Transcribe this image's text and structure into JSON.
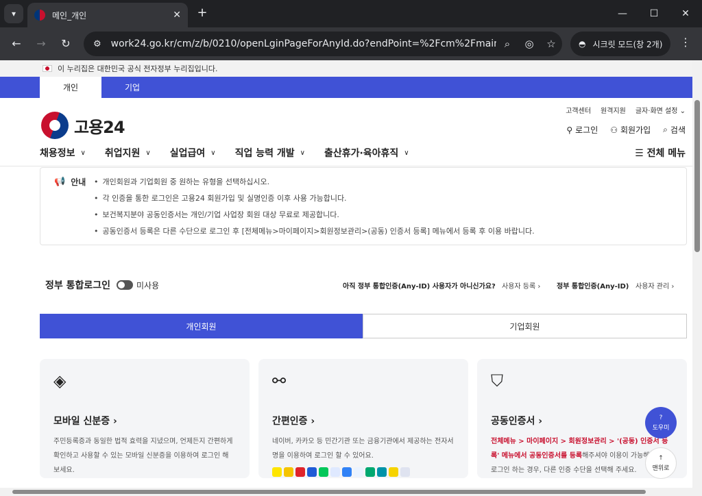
{
  "browser": {
    "tab_title": "메인_개인",
    "url": "work24.go.kr/cm/z/b/0210/openLginPageForAnyId.do?endPoint=%2Fcm%2Fmain.do...",
    "incognito_label": "시크릿 모드(창 2개)"
  },
  "gov_notice": "이 누리집은 대한민국 공식 전자정부 누리집입니다.",
  "site_tabs": {
    "personal": "개인",
    "business": "기업"
  },
  "logo_text": "고용24",
  "util_links": [
    "고객센터",
    "원격지원",
    "글자·화면 설정"
  ],
  "account": {
    "login": "로그인",
    "signup": "회원가입",
    "search": "검색"
  },
  "gnb": [
    "채용정보",
    "취업지원",
    "실업급여",
    "직업 능력 개발",
    "출산휴가·육아휴직"
  ],
  "all_menu": "전체 메뉴",
  "notice": {
    "label": "안내",
    "items": [
      "개인회원과 기업회원 중 원하는 유형을 선택하십시오.",
      "각 인증을 통한 로그인은 고용24 회원가입 및 실명인증 이후 사용 가능합니다.",
      "보건복지분야 공동인증서는 개인/기업 사업장 회원 대상 무료로 제공합니다.",
      "공동인증서 등록은 다른 수단으로 로그인 후 [전체메뉴>마이페이지>회원정보관리>(공동) 인증서 등록] 메뉴에서 등록 후 이용 바랍니다."
    ]
  },
  "integrated_login": {
    "title": "정부 통합로그인",
    "state": "미사용",
    "question": "아직 정부 통합인증(Any-ID) 사용자가 아니신가요?",
    "register_link": "사용자 등록",
    "anyid_label": "정부 통합인증(Any-ID)",
    "manage_link": "사용자 관리"
  },
  "member_tabs": {
    "personal": "개인회원",
    "business": "기업회원"
  },
  "cards": [
    {
      "title": "모바일 신분증",
      "desc": "주민등록증과 동일한 법적 효력을 지녔으며, 언제든지 간편하게 확인하고 사용할 수 있는 모바일 신분증을 이용하여 로그인 해 보세요."
    },
    {
      "title": "간편인증",
      "desc": "네이버, 카카오 등 민간기관 또는 금융기관에서 제공하는 전자서명을 이용하여 로그인 할 수 있어요."
    },
    {
      "title": "공동인증서",
      "desc_red": "전체메뉴 > 마이페이지 > 회원정보관리 > '(공동) 인증서 등록' 메뉴에서 공동인증서를 등록",
      "desc": "해주셔야 이용이 가능해요. 처음 로그인 하는 경우, 다른 인증 수단을 선택해 주세요."
    }
  ],
  "float": {
    "help": "도우미",
    "top": "맨위로"
  },
  "colors": {
    "primary": "#4052d6",
    "accent_red": "#c8102e",
    "notice_green": "#2e9b45"
  }
}
